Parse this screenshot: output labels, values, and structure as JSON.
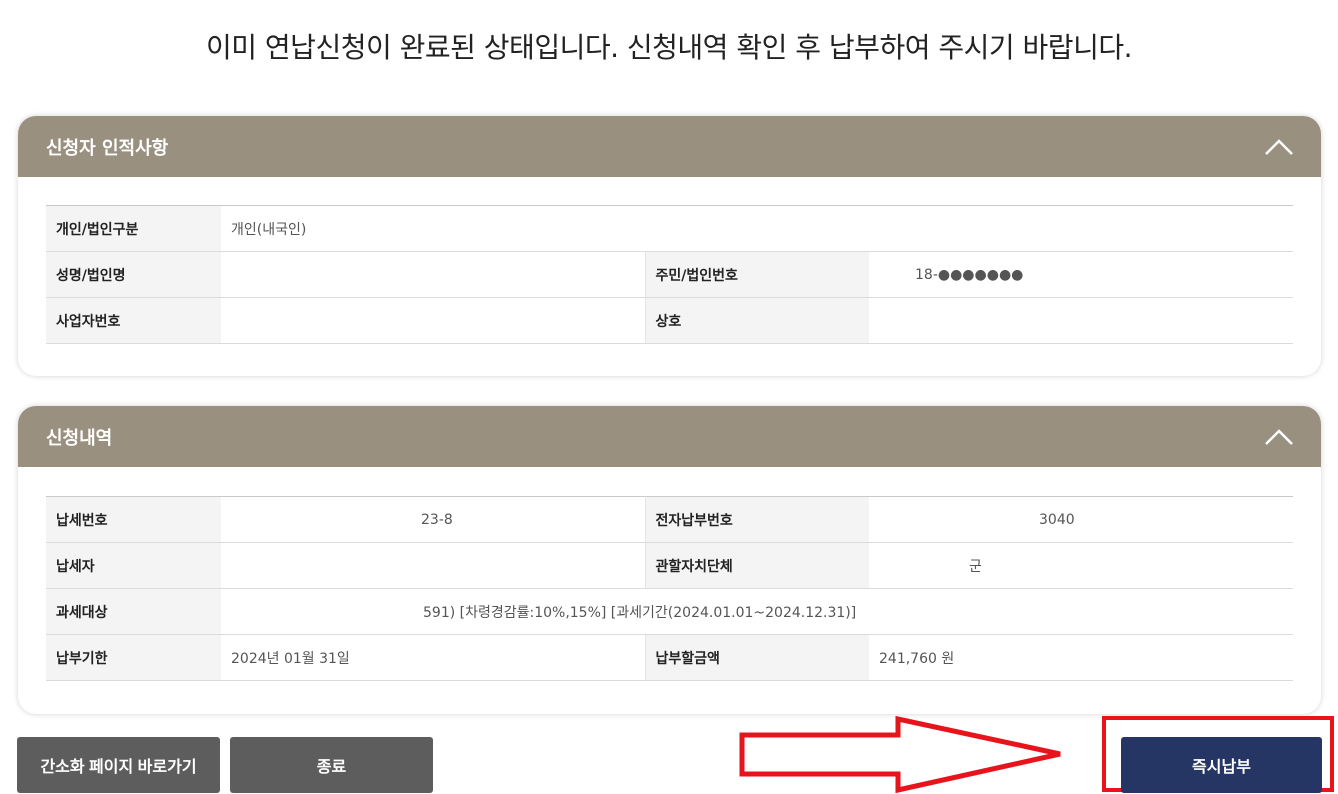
{
  "notice": "이미 연납신청이 완료된 상태입니다. 신청내역 확인 후 납부하여 주시기 바랍니다.",
  "applicant": {
    "title": "신청자 인적사항",
    "rows": {
      "type_label": "개인/법인구분",
      "type_value": "개인(내국인)",
      "name_label": "성명/법인명",
      "name_value": "",
      "id_label": "주민/법인번호",
      "id_value": "18-●●●●●●●",
      "biz_label": "사업자번호",
      "biz_value": "",
      "trade_label": "상호",
      "trade_value": ""
    }
  },
  "application": {
    "title": "신청내역",
    "rows": {
      "taxno_label": "납세번호",
      "taxno_value": "23-8",
      "epay_label": "전자납부번호",
      "epay_value": "3040",
      "payer_label": "납세자",
      "payer_value": "",
      "gov_label": "관할자치단체",
      "gov_value": "군",
      "subject_label": "과세대상",
      "subject_value": "591) [차령경감률:10%,15%] [과세기간(2024.01.01~2024.12.31)]",
      "due_label": "납부기한",
      "due_value": "2024년 01월 31일",
      "amount_label": "납부할금액",
      "amount_value": "241,760 원"
    }
  },
  "buttons": {
    "simple": "간소화 페이지 바로가기",
    "close": "종료",
    "pay": "즉시납부"
  },
  "colors": {
    "panel_header": "#9a907f",
    "button_gray": "#5d5d5d",
    "button_navy": "#253564",
    "annotation_red": "#e8141c"
  }
}
